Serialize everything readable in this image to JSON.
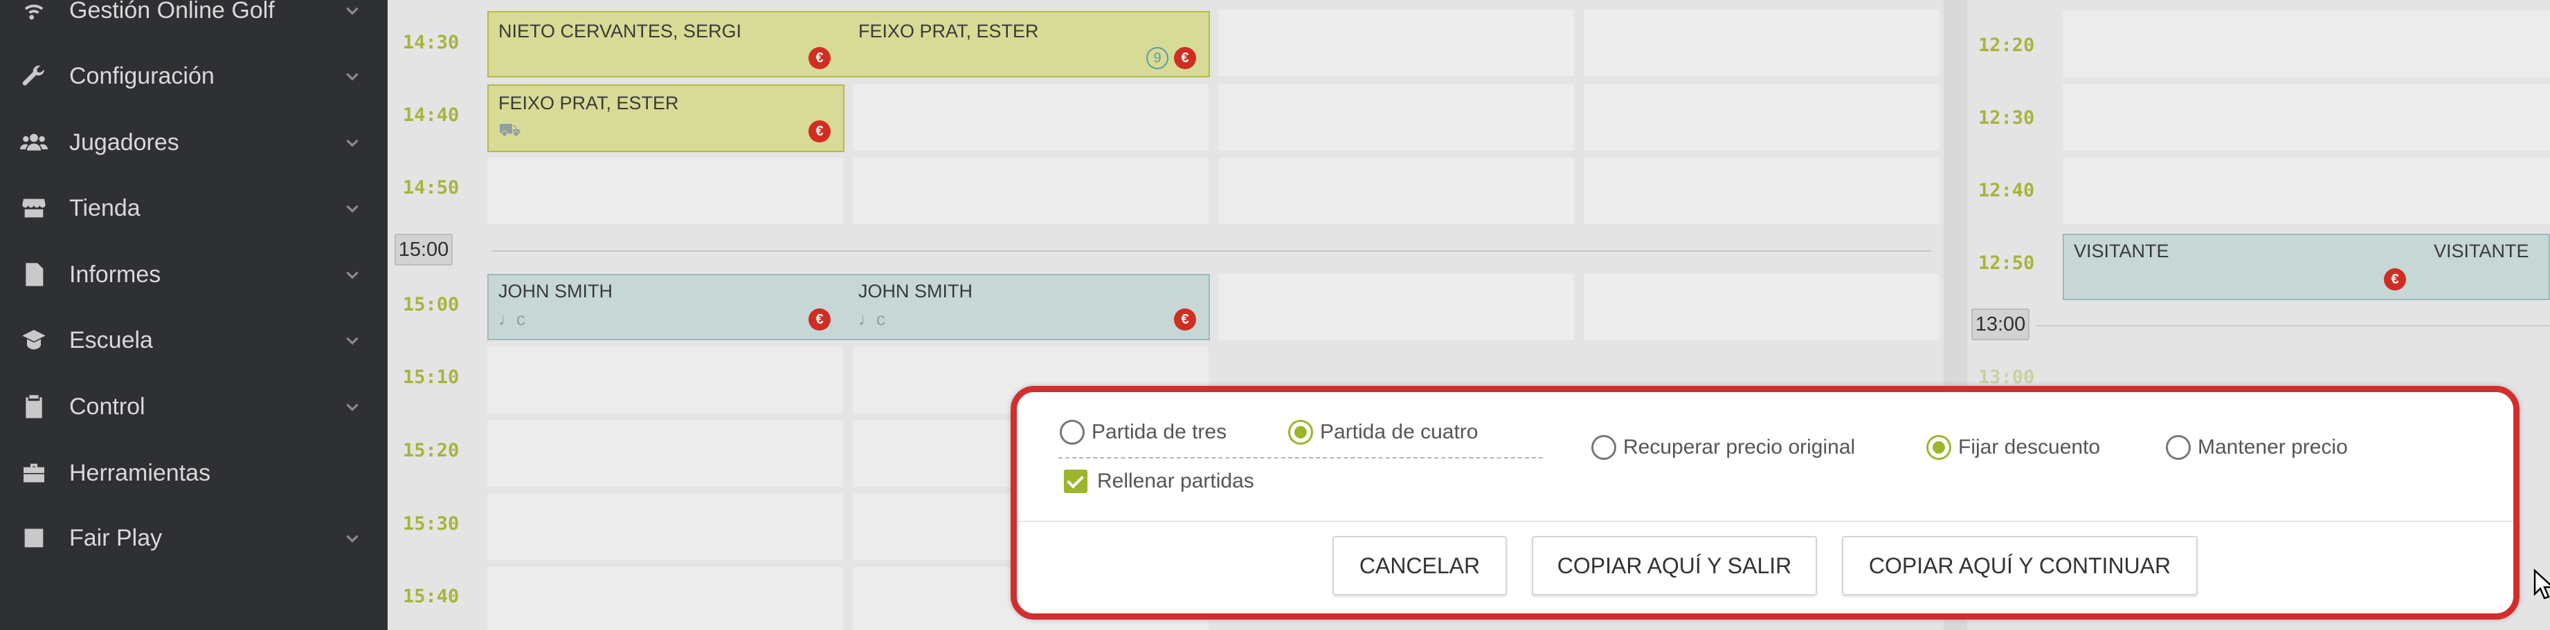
{
  "sidebar": {
    "items": [
      {
        "label": "Gestión Online Golf",
        "icon": "wifi-icon"
      },
      {
        "label": "Configuración",
        "icon": "wrench-icon"
      },
      {
        "label": "Jugadores",
        "icon": "users-icon"
      },
      {
        "label": "Tienda",
        "icon": "store-icon"
      },
      {
        "label": "Informes",
        "icon": "report-icon"
      },
      {
        "label": "Escuela",
        "icon": "school-icon"
      },
      {
        "label": "Control",
        "icon": "clipboard-icon"
      },
      {
        "label": "Herramientas",
        "icon": "toolbox-icon"
      },
      {
        "label": "Fair Play",
        "icon": "dice-icon"
      }
    ]
  },
  "grid": {
    "left_times": [
      "14:30",
      "14:40",
      "14:50",
      "15:00",
      "15:10",
      "15:20",
      "15:30",
      "15:40"
    ],
    "left_badge": "15:00",
    "right_times": [
      "12:20",
      "12:30",
      "12:40",
      "12:50",
      "13:00"
    ],
    "right_badge": "13:00",
    "bookings": [
      {
        "name": "NIETO CERVANTES, SERGI",
        "tag": "€"
      },
      {
        "name": "FEIXO PRAT, ESTER",
        "tag": "€",
        "holes": "9"
      },
      {
        "name": "FEIXO PRAT, ESTER",
        "tag": "€"
      },
      {
        "name": "JOHN SMITH",
        "tag": "€",
        "extra": "♩c"
      },
      {
        "name": "JOHN SMITH",
        "tag": "€",
        "extra": "♩c"
      },
      {
        "name": "VISITANTE",
        "tag": "€"
      },
      {
        "name": "VISITANTE"
      }
    ]
  },
  "dialog": {
    "options": {
      "partida_tres": "Partida de tres",
      "partida_cuatro": "Partida de cuatro",
      "rellenar": "Rellenar partidas",
      "recuperar": "Recuperar precio original",
      "fijar": "Fijar descuento",
      "mantener": "Mantener precio"
    },
    "selected": {
      "partida": "Partida de cuatro",
      "precio": "Fijar descuento",
      "rellenar": true
    },
    "buttons": {
      "cancel": "CANCELAR",
      "copy_exit": "COPIAR AQUÍ Y SALIR",
      "copy_continue": "COPIAR AQUÍ Y CONTINUAR"
    }
  },
  "colors": {
    "accent": "#9bb52c",
    "highlight_border": "#d22e2e",
    "booking_green": "#d7db95",
    "booking_blue": "#c6d7d6"
  }
}
